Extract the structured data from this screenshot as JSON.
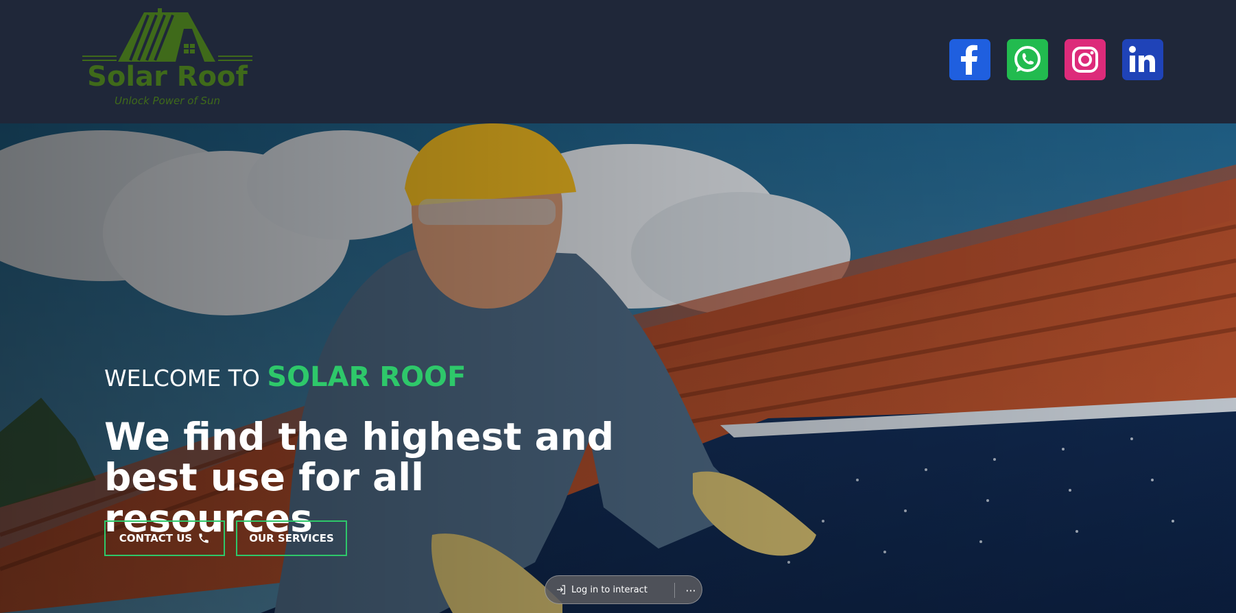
{
  "header": {
    "logo": {
      "name": "Solar Roof",
      "tagline": "Unlock Power of Sun"
    },
    "social": [
      {
        "name": "facebook",
        "icon": "facebook-icon",
        "color": "#1f5fdf"
      },
      {
        "name": "whatsapp",
        "icon": "whatsapp-icon",
        "color": "#22bb4f"
      },
      {
        "name": "instagram",
        "icon": "instagram-icon",
        "color": "#dd2b7a"
      },
      {
        "name": "linkedin",
        "icon": "linkedin-icon",
        "color": "#1f43b8"
      }
    ]
  },
  "hero": {
    "welcome_prefix": "WELCOME TO",
    "welcome_brand": "SOLAR ROOF",
    "headline_line1": "We find the highest and",
    "headline_line2": "best use for all resources",
    "buttons": {
      "contact_label": "CONTACT US",
      "contact_icon": "phone-icon",
      "services_label": "OUR SERVICES"
    },
    "image": "worker-installing-solar-panels-on-tiled-roof"
  },
  "overlay": {
    "login_label": "Log in to interact",
    "login_icon": "login-arrow-icon",
    "more_icon": "more-icon",
    "more_label": "···"
  },
  "colors": {
    "header_bg": "#1f2739",
    "accent_green": "#2ec86a",
    "logo_green": "#3f6a1a"
  }
}
